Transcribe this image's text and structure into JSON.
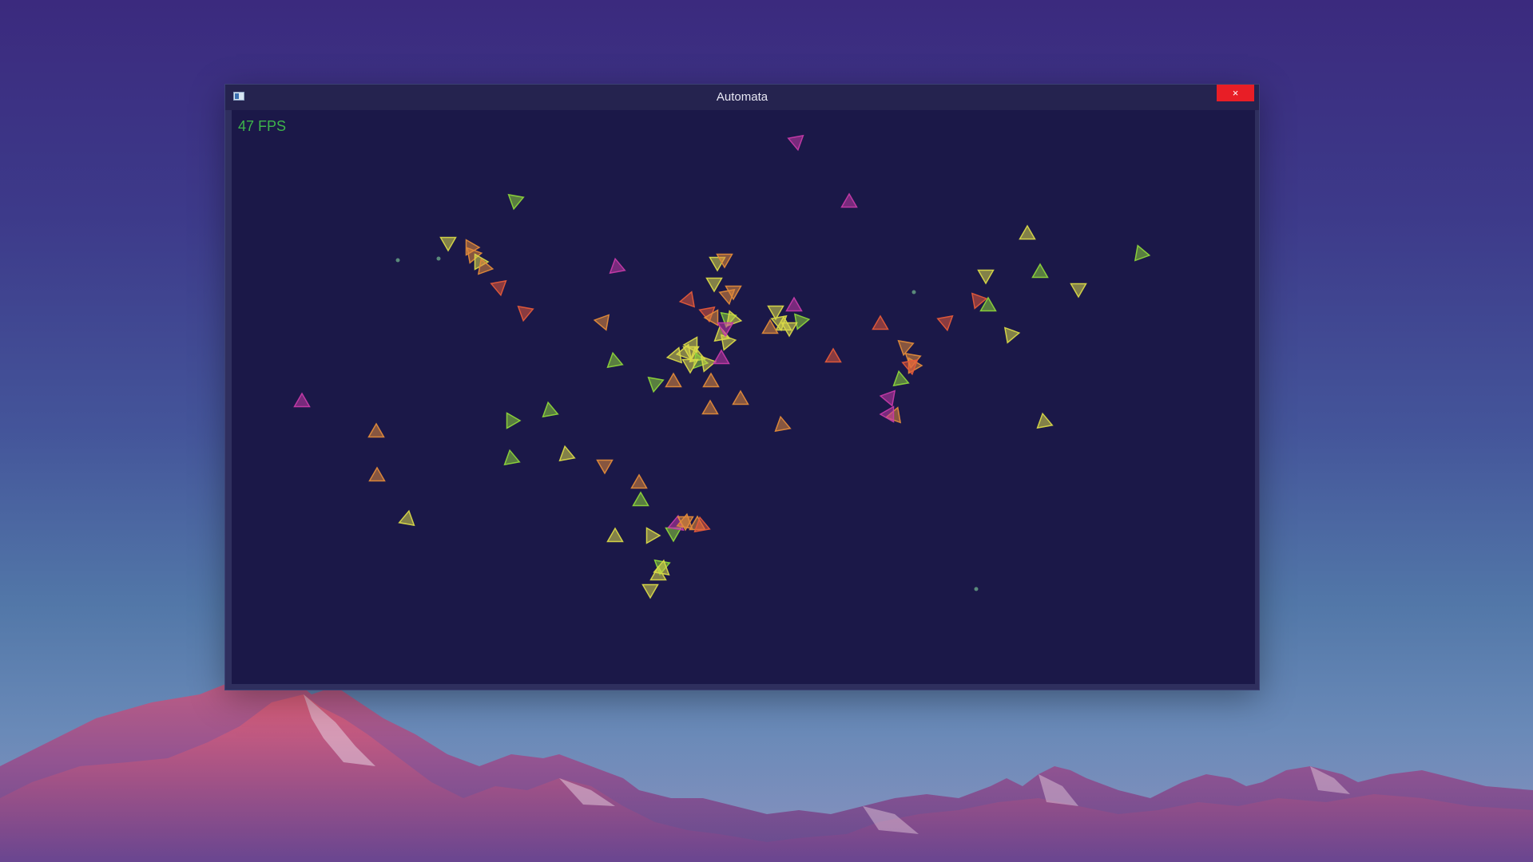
{
  "window": {
    "title": "Automata",
    "close_label": "×"
  },
  "overlay": {
    "fps": "47 FPS"
  },
  "colors": {
    "canvas_background": "#1b1848",
    "titlebar": "#25234f",
    "close_button": "#e81e26",
    "fps_text": "#3eb54a",
    "agent_yellow": "#d8d848",
    "agent_green": "#8cd43a",
    "agent_orange": "#e08a3a",
    "agent_red": "#e45a3a",
    "agent_magenta": "#c53aa8",
    "food_dot": "#5a8a7a"
  },
  "icons": {
    "app_icon": "window-app-icon",
    "close_icon": "close-icon"
  }
}
